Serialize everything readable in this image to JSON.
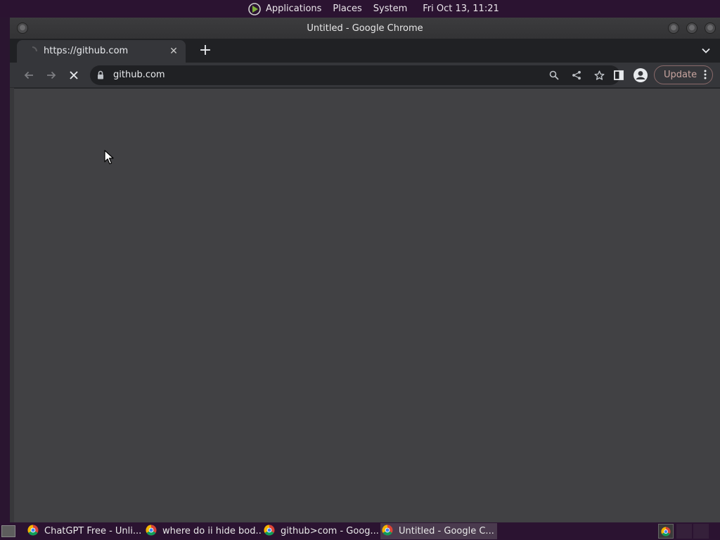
{
  "top_panel": {
    "menus": [
      "Applications",
      "Places",
      "System"
    ],
    "clock": "Fri Oct 13, 11:21"
  },
  "window": {
    "title": "Untitled - Google Chrome"
  },
  "tab": {
    "title": "https://github.com",
    "close_glyph": "✕"
  },
  "new_tab_glyph": "+",
  "omnibox": {
    "url": "github.com"
  },
  "update_button": {
    "label": "Update"
  },
  "taskbar": {
    "tasks": [
      {
        "label": "ChatGPT Free - Unli...",
        "active": false
      },
      {
        "label": "where do ii hide bod...",
        "active": false
      },
      {
        "label": "github>com - Goog...",
        "active": false
      },
      {
        "label": "Untitled - Google C...",
        "active": true
      }
    ]
  },
  "icons": {
    "app_logo": "app-logo-icon",
    "back": "arrow-left-icon",
    "forward": "arrow-right-icon",
    "stop": "close-icon",
    "lock": "lock-icon",
    "search": "search-icon",
    "share": "share-icon",
    "bookmark": "star-icon",
    "side_panel": "side-panel-icon",
    "profile": "profile-icon",
    "menu": "kebab-menu-icon",
    "tab_search": "chevron-down-icon",
    "chrome": "chrome-icon"
  },
  "colors": {
    "panel_bg": "#2b1331",
    "viewport_bg": "#414144",
    "toolbar_bg": "#35363a",
    "update_accent": "#c9a5a0"
  }
}
